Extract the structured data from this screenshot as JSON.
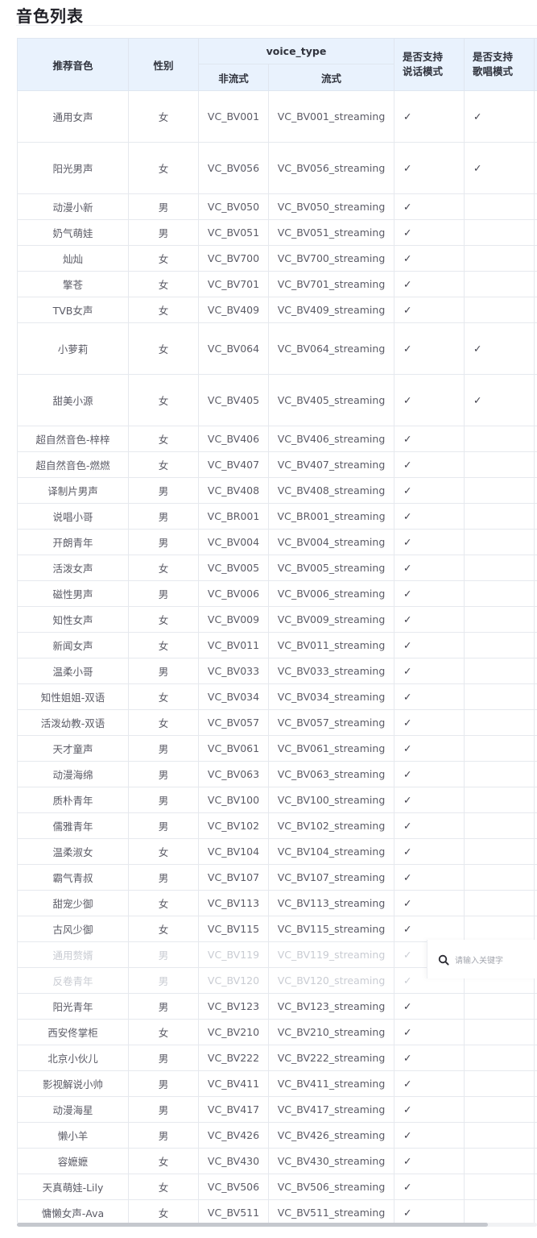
{
  "title": "音色列表",
  "headers": {
    "name": "推荐音色",
    "gender": "性别",
    "voice_type": "voice_type",
    "non_streaming": "非流式",
    "streaming": "流式",
    "speak_mode": "是否支持\n说话模式",
    "sing_mode": "是否支持\n歌唱模式"
  },
  "check_mark": "✓",
  "search": {
    "placeholder": "请输入关键字"
  },
  "colors": {
    "header_bg": "#e9f2fd",
    "border": "#e6e9ee",
    "text": "#5b5b66"
  },
  "rows": [
    {
      "name": "通用女声",
      "gender": "女",
      "id": "VC_BV001",
      "stream": "VC_BV001_streaming",
      "speak": "✓",
      "sing": "✓",
      "tall": true
    },
    {
      "name": "阳光男声",
      "gender": "女",
      "id": "VC_BV056",
      "stream": "VC_BV056_streaming",
      "speak": "✓",
      "sing": "✓",
      "tall": true
    },
    {
      "name": "动漫小新",
      "gender": "男",
      "id": "VC_BV050",
      "stream": "VC_BV050_streaming",
      "speak": "✓",
      "sing": ""
    },
    {
      "name": "奶气萌娃",
      "gender": "男",
      "id": "VC_BV051",
      "stream": "VC_BV051_streaming",
      "speak": "✓",
      "sing": ""
    },
    {
      "name": "灿灿",
      "gender": "女",
      "id": "VC_BV700",
      "stream": "VC_BV700_streaming",
      "speak": "✓",
      "sing": ""
    },
    {
      "name": "擎苍",
      "gender": "女",
      "id": "VC_BV701",
      "stream": "VC_BV701_streaming",
      "speak": "✓",
      "sing": ""
    },
    {
      "name": "TVB女声",
      "gender": "女",
      "id": "VC_BV409",
      "stream": "VC_BV409_streaming",
      "speak": "✓",
      "sing": ""
    },
    {
      "name": "小萝莉",
      "gender": "女",
      "id": "VC_BV064",
      "stream": "VC_BV064_streaming",
      "speak": "✓",
      "sing": "✓",
      "tall": true
    },
    {
      "name": "甜美小源",
      "gender": "女",
      "id": "VC_BV405",
      "stream": "VC_BV405_streaming",
      "speak": "✓",
      "sing": "✓",
      "tall": true
    },
    {
      "name": "超自然音色-梓梓",
      "gender": "女",
      "id": "VC_BV406",
      "stream": "VC_BV406_streaming",
      "speak": "✓",
      "sing": ""
    },
    {
      "name": "超自然音色-燃燃",
      "gender": "女",
      "id": "VC_BV407",
      "stream": "VC_BV407_streaming",
      "speak": "✓",
      "sing": ""
    },
    {
      "name": "译制片男声",
      "gender": "男",
      "id": "VC_BV408",
      "stream": "VC_BV408_streaming",
      "speak": "✓",
      "sing": ""
    },
    {
      "name": "说唱小哥",
      "gender": "男",
      "id": "VC_BR001",
      "stream": "VC_BR001_streaming",
      "speak": "✓",
      "sing": ""
    },
    {
      "name": "开朗青年",
      "gender": "男",
      "id": "VC_BV004",
      "stream": "VC_BV004_streaming",
      "speak": "✓",
      "sing": ""
    },
    {
      "name": "活泼女声",
      "gender": "女",
      "id": "VC_BV005",
      "stream": "VC_BV005_streaming",
      "speak": "✓",
      "sing": ""
    },
    {
      "name": "磁性男声",
      "gender": "男",
      "id": "VC_BV006",
      "stream": "VC_BV006_streaming",
      "speak": "✓",
      "sing": ""
    },
    {
      "name": "知性女声",
      "gender": "女",
      "id": "VC_BV009",
      "stream": "VC_BV009_streaming",
      "speak": "✓",
      "sing": ""
    },
    {
      "name": "新闻女声",
      "gender": "女",
      "id": "VC_BV011",
      "stream": "VC_BV011_streaming",
      "speak": "✓",
      "sing": ""
    },
    {
      "name": "温柔小哥",
      "gender": "男",
      "id": "VC_BV033",
      "stream": "VC_BV033_streaming",
      "speak": "✓",
      "sing": ""
    },
    {
      "name": "知性姐姐-双语",
      "gender": "女",
      "id": "VC_BV034",
      "stream": "VC_BV034_streaming",
      "speak": "✓",
      "sing": ""
    },
    {
      "name": "活泼幼教-双语",
      "gender": "女",
      "id": "VC_BV057",
      "stream": "VC_BV057_streaming",
      "speak": "✓",
      "sing": ""
    },
    {
      "name": "天才童声",
      "gender": "男",
      "id": "VC_BV061",
      "stream": "VC_BV061_streaming",
      "speak": "✓",
      "sing": ""
    },
    {
      "name": "动漫海绵",
      "gender": "男",
      "id": "VC_BV063",
      "stream": "VC_BV063_streaming",
      "speak": "✓",
      "sing": ""
    },
    {
      "name": "质朴青年",
      "gender": "男",
      "id": "VC_BV100",
      "stream": "VC_BV100_streaming",
      "speak": "✓",
      "sing": ""
    },
    {
      "name": "儒雅青年",
      "gender": "男",
      "id": "VC_BV102",
      "stream": "VC_BV102_streaming",
      "speak": "✓",
      "sing": ""
    },
    {
      "name": "温柔淑女",
      "gender": "女",
      "id": "VC_BV104",
      "stream": "VC_BV104_streaming",
      "speak": "✓",
      "sing": ""
    },
    {
      "name": "霸气青叔",
      "gender": "男",
      "id": "VC_BV107",
      "stream": "VC_BV107_streaming",
      "speak": "✓",
      "sing": ""
    },
    {
      "name": "甜宠少御",
      "gender": "女",
      "id": "VC_BV113",
      "stream": "VC_BV113_streaming",
      "speak": "✓",
      "sing": ""
    },
    {
      "name": "古风少御",
      "gender": "女",
      "id": "VC_BV115",
      "stream": "VC_BV115_streaming",
      "speak": "✓",
      "sing": ""
    },
    {
      "name": "通用赘婿",
      "gender": "男",
      "id": "VC_BV119",
      "stream": "VC_BV119_streaming",
      "speak": "✓",
      "sing": "",
      "faded": true
    },
    {
      "name": "反卷青年",
      "gender": "男",
      "id": "VC_BV120",
      "stream": "VC_BV120_streaming",
      "speak": "✓",
      "sing": "",
      "faded": true
    },
    {
      "name": "阳光青年",
      "gender": "男",
      "id": "VC_BV123",
      "stream": "VC_BV123_streaming",
      "speak": "✓",
      "sing": ""
    },
    {
      "name": "西安佟掌柜",
      "gender": "女",
      "id": "VC_BV210",
      "stream": "VC_BV210_streaming",
      "speak": "✓",
      "sing": ""
    },
    {
      "name": "北京小伙儿",
      "gender": "男",
      "id": "VC_BV222",
      "stream": "VC_BV222_streaming",
      "speak": "✓",
      "sing": ""
    },
    {
      "name": "影视解说小帅",
      "gender": "男",
      "id": "VC_BV411",
      "stream": "VC_BV411_streaming",
      "speak": "✓",
      "sing": ""
    },
    {
      "name": "动漫海星",
      "gender": "男",
      "id": "VC_BV417",
      "stream": "VC_BV417_streaming",
      "speak": "✓",
      "sing": ""
    },
    {
      "name": "懒小羊",
      "gender": "男",
      "id": "VC_BV426",
      "stream": "VC_BV426_streaming",
      "speak": "✓",
      "sing": ""
    },
    {
      "name": "容嬷嬷",
      "gender": "女",
      "id": "VC_BV430",
      "stream": "VC_BV430_streaming",
      "speak": "✓",
      "sing": ""
    },
    {
      "name": "天真萌娃-Lily",
      "gender": "女",
      "id": "VC_BV506",
      "stream": "VC_BV506_streaming",
      "speak": "✓",
      "sing": ""
    },
    {
      "name": "慵懒女声-Ava",
      "gender": "女",
      "id": "VC_BV511",
      "stream": "VC_BV511_streaming",
      "speak": "✓",
      "sing": ""
    }
  ]
}
